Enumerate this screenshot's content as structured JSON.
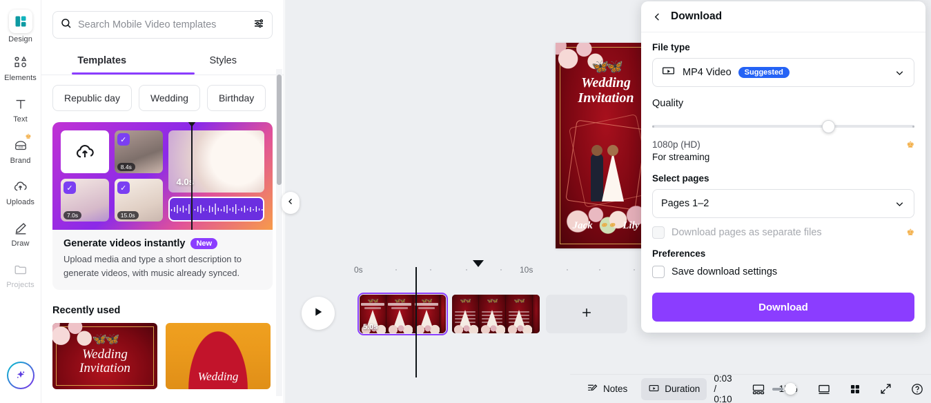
{
  "rail": {
    "items": [
      {
        "label": "Design",
        "icon": "design-icon",
        "active": true,
        "dim": false,
        "crown": false
      },
      {
        "label": "Elements",
        "icon": "elements-icon",
        "active": false,
        "dim": false,
        "crown": false
      },
      {
        "label": "Text",
        "icon": "text-icon",
        "active": false,
        "dim": false,
        "crown": false
      },
      {
        "label": "Brand",
        "icon": "brand-icon",
        "active": false,
        "dim": false,
        "crown": true
      },
      {
        "label": "Uploads",
        "icon": "uploads-icon",
        "active": false,
        "dim": false,
        "crown": false
      },
      {
        "label": "Draw",
        "icon": "draw-icon",
        "active": false,
        "dim": false,
        "crown": false
      },
      {
        "label": "Projects",
        "icon": "projects-icon",
        "active": false,
        "dim": true,
        "crown": false
      }
    ],
    "ai_button": "magic-sparkle-icon"
  },
  "panel": {
    "search": {
      "placeholder": "Search Mobile Video templates",
      "value": "",
      "icon": "search-icon",
      "filter_icon": "filter-sliders-icon"
    },
    "tabs": [
      {
        "label": "Templates",
        "active": true
      },
      {
        "label": "Styles",
        "active": false
      }
    ],
    "chips": [
      "Republic day",
      "Wedding",
      "Birthday"
    ],
    "chips_next_icon": "chevron-right-icon",
    "promo": {
      "title": "Generate videos instantly",
      "badge": "New",
      "description": "Upload media and type a short description to generate videos, with music already synced.",
      "thumb_durations": [
        "8.4s",
        "7.0s",
        "15.0s"
      ],
      "preview_duration": "4.0s",
      "upload_icon": "cloud-upload-icon"
    },
    "recently_used": {
      "heading": "Recently used",
      "items": [
        {
          "line1": "Wedding",
          "line2": "Invitation"
        },
        {
          "line1": "Wedding",
          "line2": ""
        }
      ]
    }
  },
  "collapse_handle": {
    "icon": "chevron-left-icon"
  },
  "canvas": {
    "page": {
      "title_line1": "Wedding",
      "title_line2": "Invitation",
      "name_left": "Jack",
      "name_right": "Lily",
      "rings_icon": "wedding-rings-icon",
      "doves_icon": "doves-icon"
    }
  },
  "timeline": {
    "ruler_labels": [
      "0s",
      "10s"
    ],
    "play_icon": "play-icon",
    "scenes": [
      {
        "duration": "5.0s",
        "selected": true
      },
      {
        "duration": "",
        "selected": false
      }
    ],
    "add_scene_icon": "plus-icon"
  },
  "bottombar": {
    "notes_label": "Notes",
    "notes_icon": "notes-icon",
    "duration_label": "Duration",
    "duration_icon": "duration-video-icon",
    "timecode": "0:03 / 0:10",
    "timeline_toggle_icon": "timeline-view-icon",
    "zoom_pct": "15%",
    "fit_icon": "fit-page-icon",
    "grid_icon": "grid-view-icon",
    "fullscreen_icon": "fullscreen-icon",
    "help_icon": "help-circle-icon"
  },
  "download_panel": {
    "back_icon": "chevron-left-icon",
    "title": "Download",
    "file_type": {
      "label": "File type",
      "value": "MP4 Video",
      "badge": "Suggested",
      "icon": "video-file-icon",
      "chevron": "chevron-down-icon"
    },
    "quality": {
      "label": "Quality",
      "resolution": "1080p (HD)",
      "subtitle": "For streaming",
      "crown_icon": "crown-icon",
      "slider_percent": 66
    },
    "select_pages": {
      "label": "Select pages",
      "value": "Pages 1–2",
      "chevron": "chevron-down-icon"
    },
    "separate_files": {
      "label": "Download pages as separate files",
      "checked": false,
      "disabled": true,
      "crown_icon": "crown-icon"
    },
    "preferences": {
      "label": "Preferences",
      "save_settings_label": "Save download settings",
      "checked": false
    },
    "download_button": "Download"
  },
  "colors": {
    "accent_purple": "#8b3dff",
    "suggested_blue": "#2563f5",
    "crown_gold": "#f2a93b",
    "editor_bg": "#edeff2"
  }
}
